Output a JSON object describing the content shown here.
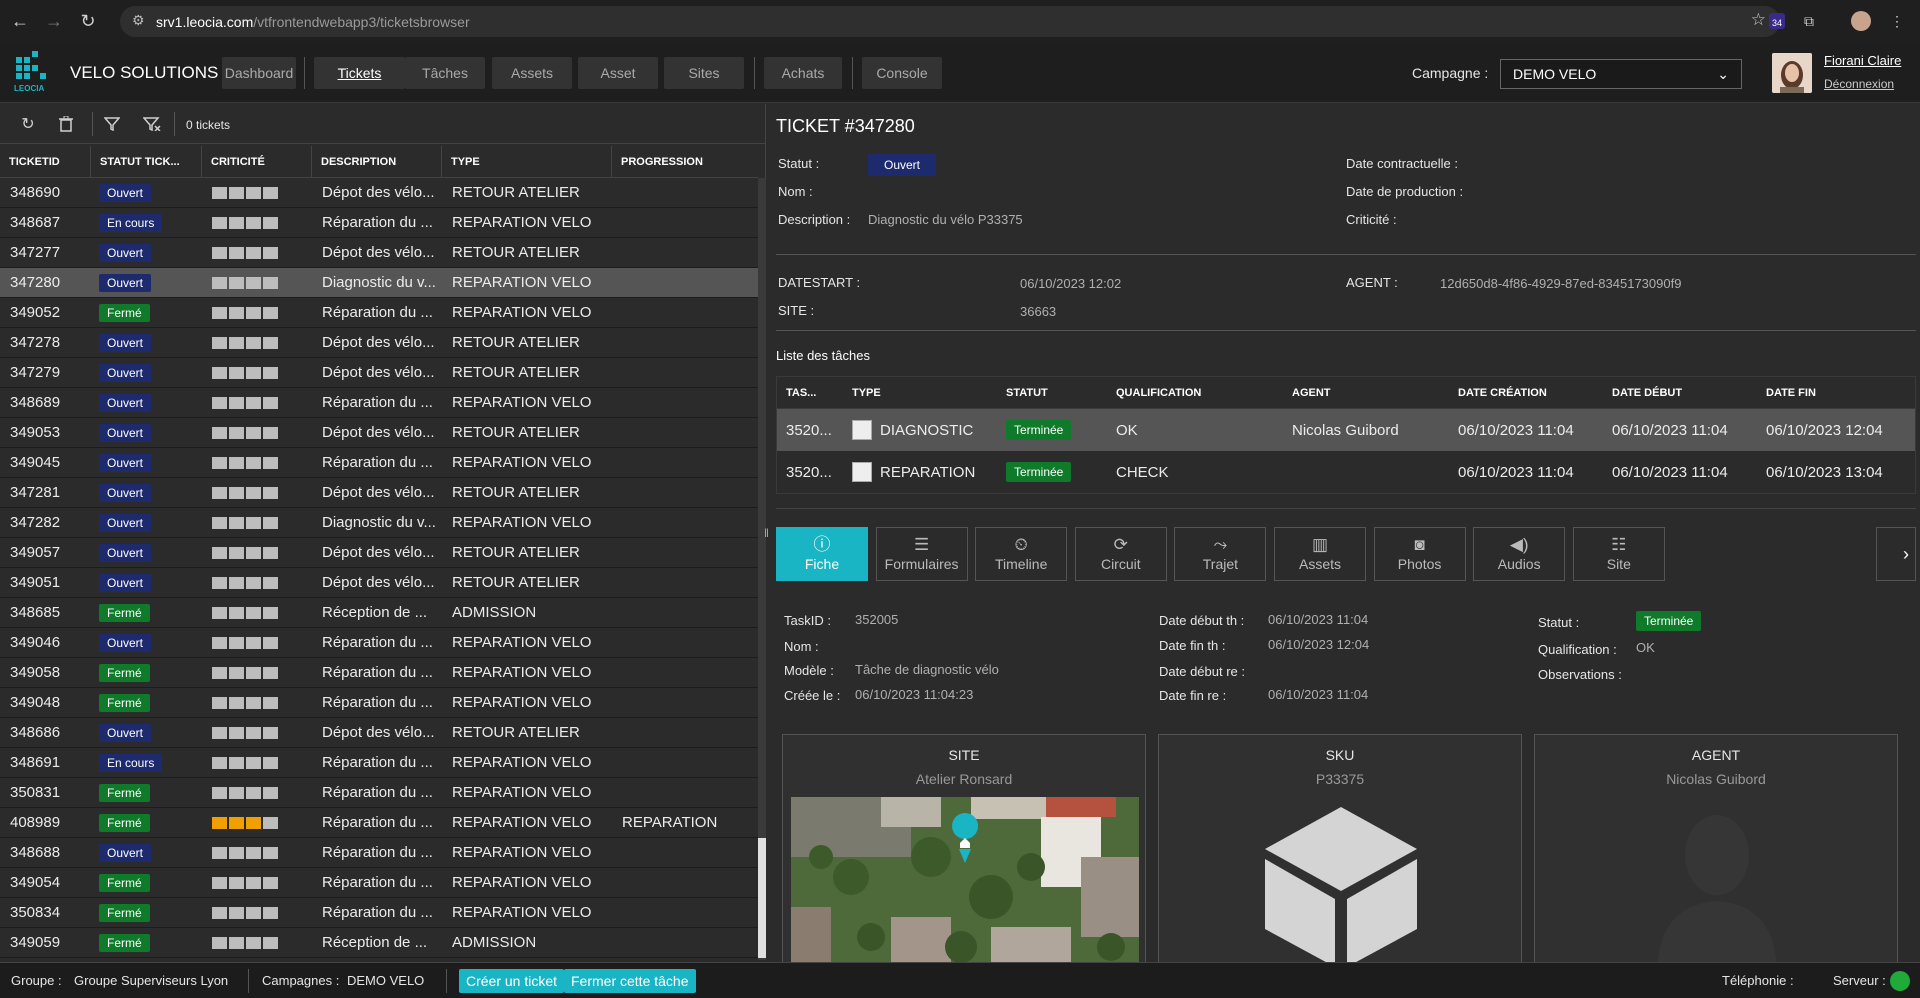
{
  "browser": {
    "url_host": "srv1.leocia.com",
    "url_path": "/vtfrontendwebapp3/ticketsbrowser",
    "ext_badge": "34"
  },
  "header": {
    "logo_text": "LEOCIA",
    "app_name": "VELO SOLUTIONS",
    "nav": [
      "Dashboard",
      "Tickets",
      "Tâches",
      "Assets",
      "Asset",
      "Sites",
      "Achats",
      "Console"
    ],
    "active_nav": "Tickets",
    "campagne_label": "Campagne :",
    "campagne_value": "DEMO VELO",
    "user_name": "Fiorani Claire",
    "logout": "Déconnexion"
  },
  "left": {
    "ticket_count": "0 tickets",
    "columns": [
      "TICKETID",
      "STATUT TICK...",
      "CRITICITÉ",
      "DESCRIPTION",
      "TYPE",
      "PROGRESSION"
    ],
    "rows": [
      {
        "id": "348690",
        "status": "Ouvert",
        "kind": "ouvert",
        "crit": 0,
        "desc": "Dépot des vélo...",
        "type": "RETOUR ATELIER",
        "prog": ""
      },
      {
        "id": "348687",
        "status": "En cours",
        "kind": "encours",
        "crit": 0,
        "desc": "Réparation du ...",
        "type": "REPARATION VELO",
        "prog": ""
      },
      {
        "id": "347277",
        "status": "Ouvert",
        "kind": "ouvert",
        "crit": 0,
        "desc": "Dépot des vélo...",
        "type": "RETOUR ATELIER",
        "prog": ""
      },
      {
        "id": "347280",
        "status": "Ouvert",
        "kind": "ouvert",
        "crit": 0,
        "desc": "Diagnostic du v...",
        "type": "REPARATION VELO",
        "prog": "",
        "selected": true
      },
      {
        "id": "349052",
        "status": "Fermé",
        "kind": "ferme",
        "crit": 0,
        "desc": "Réparation du ...",
        "type": "REPARATION VELO",
        "prog": ""
      },
      {
        "id": "347278",
        "status": "Ouvert",
        "kind": "ouvert",
        "crit": 0,
        "desc": "Dépot des vélo...",
        "type": "RETOUR ATELIER",
        "prog": ""
      },
      {
        "id": "347279",
        "status": "Ouvert",
        "kind": "ouvert",
        "crit": 0,
        "desc": "Dépot des vélo...",
        "type": "RETOUR ATELIER",
        "prog": ""
      },
      {
        "id": "348689",
        "status": "Ouvert",
        "kind": "ouvert",
        "crit": 0,
        "desc": "Réparation du ...",
        "type": "REPARATION VELO",
        "prog": ""
      },
      {
        "id": "349053",
        "status": "Ouvert",
        "kind": "ouvert",
        "crit": 0,
        "desc": "Dépot des vélo...",
        "type": "RETOUR ATELIER",
        "prog": ""
      },
      {
        "id": "349045",
        "status": "Ouvert",
        "kind": "ouvert",
        "crit": 0,
        "desc": "Réparation du ...",
        "type": "REPARATION VELO",
        "prog": ""
      },
      {
        "id": "347281",
        "status": "Ouvert",
        "kind": "ouvert",
        "crit": 0,
        "desc": "Dépot des vélo...",
        "type": "RETOUR ATELIER",
        "prog": ""
      },
      {
        "id": "347282",
        "status": "Ouvert",
        "kind": "ouvert",
        "crit": 0,
        "desc": "Diagnostic du v...",
        "type": "REPARATION VELO",
        "prog": ""
      },
      {
        "id": "349057",
        "status": "Ouvert",
        "kind": "ouvert",
        "crit": 0,
        "desc": "Dépot des vélo...",
        "type": "RETOUR ATELIER",
        "prog": ""
      },
      {
        "id": "349051",
        "status": "Ouvert",
        "kind": "ouvert",
        "crit": 0,
        "desc": "Dépot des vélo...",
        "type": "RETOUR ATELIER",
        "prog": ""
      },
      {
        "id": "348685",
        "status": "Fermé",
        "kind": "ferme",
        "crit": 0,
        "desc": "Réception de ...",
        "type": "ADMISSION",
        "prog": ""
      },
      {
        "id": "349046",
        "status": "Ouvert",
        "kind": "ouvert",
        "crit": 0,
        "desc": "Réparation du ...",
        "type": "REPARATION VELO",
        "prog": ""
      },
      {
        "id": "349058",
        "status": "Fermé",
        "kind": "ferme",
        "crit": 0,
        "desc": "Réparation du ...",
        "type": "REPARATION VELO",
        "prog": ""
      },
      {
        "id": "349048",
        "status": "Fermé",
        "kind": "ferme",
        "crit": 0,
        "desc": "Réparation du ...",
        "type": "REPARATION VELO",
        "prog": ""
      },
      {
        "id": "348686",
        "status": "Ouvert",
        "kind": "ouvert",
        "crit": 0,
        "desc": "Dépot des vélo...",
        "type": "RETOUR ATELIER",
        "prog": ""
      },
      {
        "id": "348691",
        "status": "En cours",
        "kind": "encours",
        "crit": 0,
        "desc": "Réparation du ...",
        "type": "REPARATION VELO",
        "prog": ""
      },
      {
        "id": "350831",
        "status": "Fermé",
        "kind": "ferme",
        "crit": 0,
        "desc": "Réparation du ...",
        "type": "REPARATION VELO",
        "prog": ""
      },
      {
        "id": "408989",
        "status": "Fermé",
        "kind": "ferme",
        "crit": 3,
        "desc": "Réparation du ...",
        "type": "REPARATION VELO",
        "prog": "REPARATION"
      },
      {
        "id": "348688",
        "status": "Ouvert",
        "kind": "ouvert",
        "crit": 0,
        "desc": "Réparation du ...",
        "type": "REPARATION VELO",
        "prog": ""
      },
      {
        "id": "349054",
        "status": "Fermé",
        "kind": "ferme",
        "crit": 0,
        "desc": "Réparation du ...",
        "type": "REPARATION VELO",
        "prog": ""
      },
      {
        "id": "350834",
        "status": "Fermé",
        "kind": "ferme",
        "crit": 0,
        "desc": "Réparation du ...",
        "type": "REPARATION VELO",
        "prog": ""
      },
      {
        "id": "349059",
        "status": "Fermé",
        "kind": "ferme",
        "crit": 0,
        "desc": "Réception de ...",
        "type": "ADMISSION",
        "prog": ""
      }
    ]
  },
  "ticket": {
    "title": "TICKET #347280",
    "statut_label": "Statut :",
    "statut_value": "Ouvert",
    "nom_label": "Nom :",
    "description_label": "Description :",
    "description_value": "Diagnostic du vélo P33375",
    "date_contractuelle_label": "Date contractuelle :",
    "date_production_label": "Date de production :",
    "criticite_label": "Criticité :",
    "datestart_label": "DATESTART :",
    "datestart_value": "06/10/2023 12:02",
    "site_label": "SITE :",
    "site_value": "36663",
    "agent_label": "AGENT :",
    "agent_value": "12d650d8-4f86-4929-87ed-8345173090f9"
  },
  "tasks": {
    "title": "Liste des tâches",
    "columns": [
      "TAS...",
      "TYPE",
      "STATUT",
      "QUALIFICATION",
      "AGENT",
      "DATE CRÉATION",
      "DATE DÉBUT",
      "DATE FIN"
    ],
    "rows": [
      {
        "id": "3520...",
        "type": "DIAGNOSTIC",
        "status": "Terminée",
        "qual": "OK",
        "agent": "Nicolas Guibord",
        "created": "06/10/2023 11:04",
        "start": "06/10/2023 11:04",
        "end": "06/10/2023 12:04",
        "selected": true
      },
      {
        "id": "3520...",
        "type": "REPARATION",
        "status": "Terminée",
        "qual": "CHECK",
        "agent": "",
        "created": "06/10/2023 11:04",
        "start": "06/10/2023 11:04",
        "end": "06/10/2023 13:04"
      }
    ]
  },
  "tabs": [
    {
      "label": "Fiche",
      "icon": "info-icon",
      "glyph": "ⓘ"
    },
    {
      "label": "Formulaires",
      "icon": "list-icon",
      "glyph": "☰"
    },
    {
      "label": "Timeline",
      "icon": "timeline-icon",
      "glyph": "⏲"
    },
    {
      "label": "Circuit",
      "icon": "circuit-icon",
      "glyph": "⟳"
    },
    {
      "label": "Trajet",
      "icon": "route-icon",
      "glyph": "⤳"
    },
    {
      "label": "Assets",
      "icon": "barcode-icon",
      "glyph": "▥"
    },
    {
      "label": "Photos",
      "icon": "camera-icon",
      "glyph": "◙"
    },
    {
      "label": "Audios",
      "icon": "speaker-icon",
      "glyph": "◀)"
    },
    {
      "label": "Site",
      "icon": "checklist-icon",
      "glyph": "☷"
    }
  ],
  "task_detail": {
    "taskid_label": "TaskID :",
    "taskid_value": "352005",
    "nom_label": "Nom :",
    "modele_label": "Modèle :",
    "modele_value": "Tâche de diagnostic vélo",
    "creee_label": "Créée le :",
    "creee_value": "06/10/2023 11:04:23",
    "debut_th_label": "Date début th :",
    "debut_th_value": "06/10/2023 11:04",
    "fin_th_label": "Date fin th :",
    "fin_th_value": "06/10/2023 12:04",
    "debut_re_label": "Date début re :",
    "fin_re_label": "Date fin re :",
    "fin_re_value": "06/10/2023 11:04",
    "statut_label": "Statut :",
    "statut_value": "Terminée",
    "qual_label": "Qualification :",
    "qual_value": "OK",
    "obs_label": "Observations :"
  },
  "cards": {
    "site_title": "SITE",
    "site_sub": "Atelier Ronsard",
    "sku_title": "SKU",
    "sku_sub": "P33375",
    "agent_title": "AGENT",
    "agent_sub": "Nicolas Guibord"
  },
  "footer": {
    "groupe_label": "Groupe :",
    "groupe_value": "Groupe Superviseurs Lyon",
    "campagnes_label": "Campagnes :",
    "campagnes_value": "DEMO VELO",
    "create_ticket": "Créer un ticket",
    "close_task": "Fermer cette tâche",
    "telephonie_label": "Téléphonie :",
    "serveur_label": "Serveur :"
  },
  "colors": {
    "accent": "#1ab5c4",
    "badge_open": "#1e2a6e",
    "badge_closed": "#0e7a2a",
    "criticity_high": "#f0a000",
    "server_ok": "#1faa3a"
  }
}
